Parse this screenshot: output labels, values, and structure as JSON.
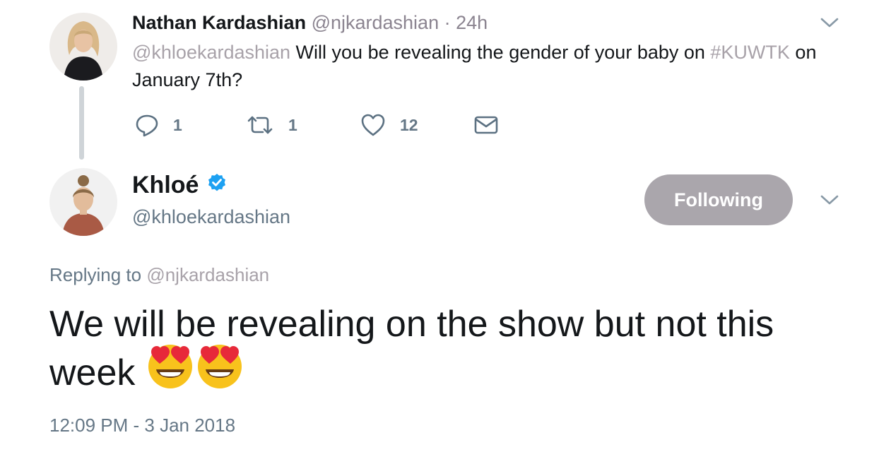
{
  "parent_tweet": {
    "author_name": "Nathan Kardashian",
    "author_handle": "@njkardashian",
    "separator": "·",
    "time_ago": "24h",
    "text_mention": "@khloekardashian",
    "text_part1": " Will you be revealing the gender of your baby on ",
    "text_hashtag": "#KUWTK",
    "text_part2": " on January 7th?",
    "actions": {
      "reply_count": "1",
      "retweet_count": "1",
      "like_count": "12"
    },
    "icons": [
      "reply-icon",
      "retweet-icon",
      "heart-icon",
      "mail-icon",
      "chevron-down-icon"
    ]
  },
  "main_tweet": {
    "author_name": "Khloé",
    "author_handle": "@khloekardashian",
    "verified": true,
    "follow_label": "Following",
    "replying_prefix": "Replying to ",
    "replying_handle": "@njkardashian",
    "text": "We will be revealing on the show but not this week",
    "emojis": [
      "heart-eyes-emoji",
      "heart-eyes-emoji"
    ],
    "timestamp": "12:09 PM - 3 Jan 2018"
  },
  "colors": {
    "text": "#14171a",
    "secondary": "#657786",
    "mention": "#a8a2a9",
    "following_button": "#aaa6ac",
    "verified": "#1da1f2",
    "thread_line": "#cfd4d8"
  }
}
